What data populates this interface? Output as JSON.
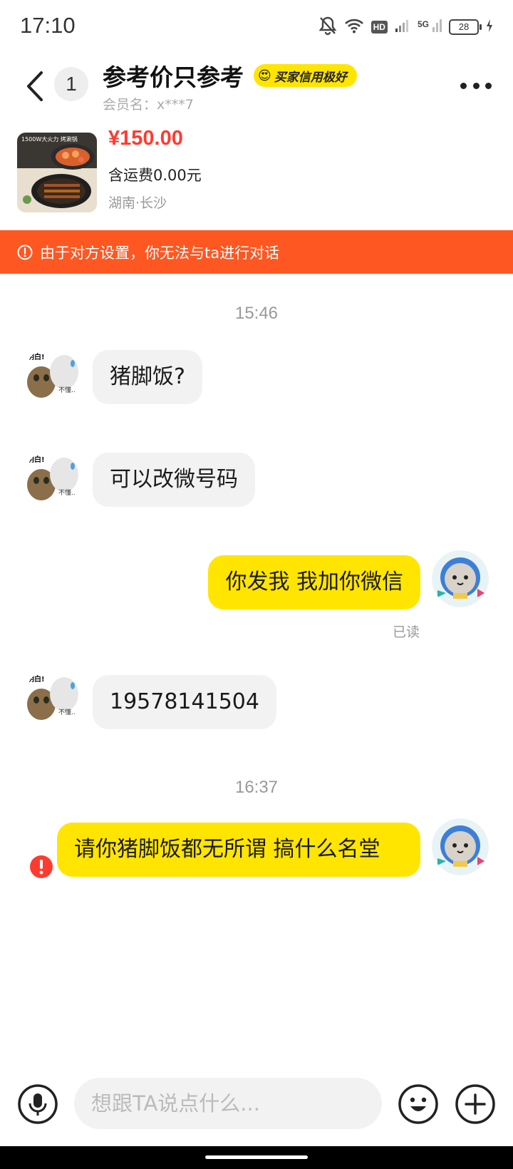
{
  "status_bar": {
    "time": "17:10",
    "hd": "HD",
    "signal_label": "5G",
    "battery": "28"
  },
  "header": {
    "unread_count": "1",
    "title": "参考价只参考",
    "credit_badge": "买家信用极好",
    "member_name": "会员名：x***7"
  },
  "product": {
    "price": "¥150.00",
    "shipping": "含运费0.00元",
    "location": "湖南·长沙",
    "thumb_caption": "1500W大火力 烤涮锅"
  },
  "warning": {
    "text": "由于对方设置，你无法与ta进行对话",
    "color": "#ff5722"
  },
  "messages": {
    "time_1": "15:46",
    "m1": "猪脚饭?",
    "m2": "可以改微号码",
    "m3": "你发我  我加你微信",
    "m3_status": "已读",
    "m4": "19578141504",
    "time_2": "16:37",
    "m5": "请你猪脚饭都无所谓  搞什么名堂"
  },
  "sticker": {
    "text_1": "明白!",
    "text_2": "不懂..."
  },
  "input": {
    "placeholder": "想跟TA说点什么..."
  },
  "colors": {
    "accent_yellow": "#ffe500",
    "price_red": "#ff3b30",
    "incoming_bubble": "#f2f2f2"
  }
}
